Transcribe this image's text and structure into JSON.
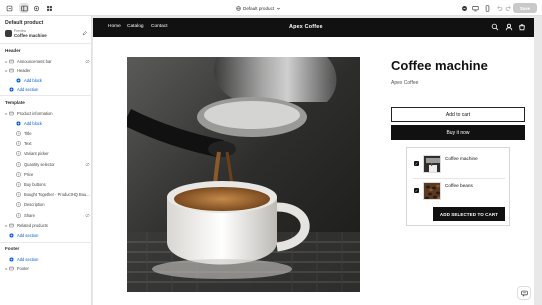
{
  "topbar": {
    "template_selector": "Default product",
    "save_label": "Save"
  },
  "sidebar": {
    "title": "Default product",
    "product": {
      "small": "Preview",
      "name": "Coffee machine"
    },
    "header_section": "Header",
    "header_items": [
      {
        "label": "Announcement bar",
        "level": 1
      },
      {
        "label": "Header",
        "level": 1
      },
      {
        "label": "Add block",
        "level": 2,
        "add": true
      },
      {
        "label": "Add section",
        "level": 1,
        "add": true
      }
    ],
    "template_section": "Template",
    "template_items": [
      {
        "label": "Product information",
        "level": 1
      },
      {
        "label": "Add block",
        "level": 2,
        "add": true
      },
      {
        "label": "Title",
        "level": 2
      },
      {
        "label": "Text",
        "level": 2
      },
      {
        "label": "Variant picker",
        "level": 2
      },
      {
        "label": "Quantity selector",
        "level": 2
      },
      {
        "label": "Price",
        "level": 2
      },
      {
        "label": "Buy buttons",
        "level": 2
      },
      {
        "label": "Bought Together - ProductHQ Bou...",
        "level": 2
      },
      {
        "label": "Description",
        "level": 2
      },
      {
        "label": "Share",
        "level": 2
      },
      {
        "label": "Related products",
        "level": 1
      },
      {
        "label": "Add section",
        "level": 1,
        "add": true
      }
    ],
    "footer_section": "Footer",
    "footer_items": [
      {
        "label": "Add section",
        "level": 1,
        "add": true
      },
      {
        "label": "Footer",
        "level": 1
      }
    ]
  },
  "store": {
    "nav_links": [
      "Home",
      "Catalog",
      "Contact"
    ],
    "brand": "Apex Coffee",
    "product_title": "Coffee machine",
    "vendor": "Apex Coffee",
    "add_to_cart": "Add to cart",
    "buy_now": "Buy it now",
    "bundle": {
      "items": [
        {
          "name": "Coffee machine",
          "checked": true
        },
        {
          "name": "Coffee beans",
          "checked": true
        }
      ],
      "button": "ADD SELECTED TO CART"
    }
  },
  "icons": {
    "nav": [
      "search-icon",
      "account-icon",
      "cart-icon"
    ],
    "topbar": [
      "exit-icon",
      "sidebar-icon",
      "settings-icon",
      "apps-icon",
      "globe-icon",
      "inspector-icon",
      "desktop-icon",
      "mobile-icon",
      "undo-icon",
      "redo-icon"
    ]
  },
  "colors": {
    "accent_link": "#005bd3",
    "store_nav": "#111111",
    "button_dark": "#111111"
  }
}
